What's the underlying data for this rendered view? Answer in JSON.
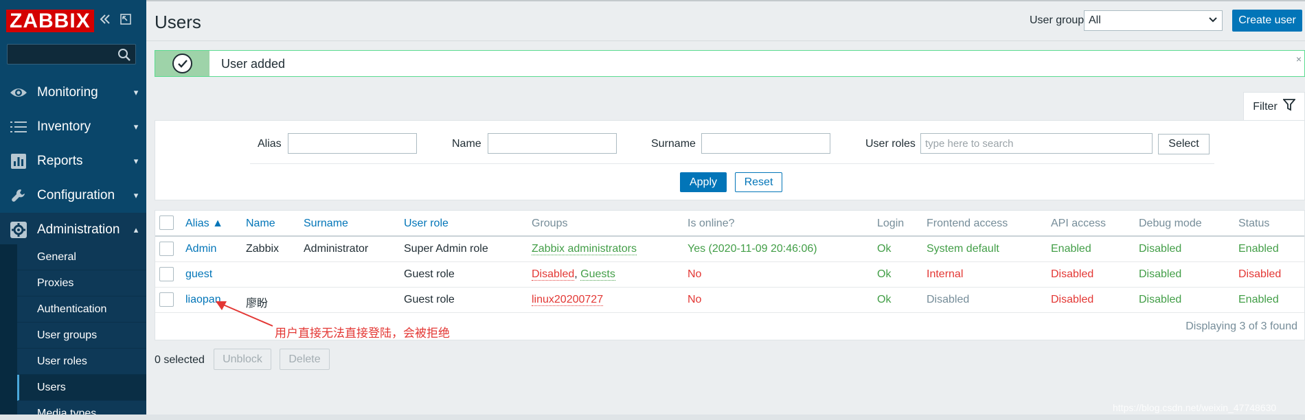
{
  "sidebar": {
    "logo": "ZABBIX",
    "collapse_icon": "double-chevron-left",
    "kiosk_icon": "expand-icon",
    "menu": [
      {
        "label": "Monitoring",
        "icon": "eye-icon",
        "chevron": "⌄"
      },
      {
        "label": "Inventory",
        "icon": "list-icon",
        "chevron": "⌄"
      },
      {
        "label": "Reports",
        "icon": "bar-chart-icon",
        "chevron": "⌄"
      },
      {
        "label": "Configuration",
        "icon": "wrench-icon",
        "chevron": "⌄"
      },
      {
        "label": "Administration",
        "icon": "gear-icon",
        "chevron": "⌃"
      }
    ],
    "submenu": [
      "General",
      "Proxies",
      "Authentication",
      "User groups",
      "User roles",
      "Users",
      "Media types"
    ]
  },
  "header": {
    "title": "Users",
    "user_group_label": "User group",
    "user_group_value": "All",
    "create_button": "Create user"
  },
  "message": {
    "text": "User added",
    "close": "×"
  },
  "filter": {
    "tab_label": "Filter",
    "alias_label": "Alias",
    "name_label": "Name",
    "surname_label": "Surname",
    "roles_label": "User roles",
    "roles_placeholder": "type here to search",
    "select_button": "Select",
    "apply_button": "Apply",
    "reset_button": "Reset"
  },
  "table": {
    "columns": [
      "Alias ▲",
      "Name",
      "Surname",
      "User role",
      "Groups",
      "Is online?",
      "Login",
      "Frontend access",
      "API access",
      "Debug mode",
      "Status"
    ],
    "rows": [
      {
        "alias": "Admin",
        "name": "Zabbix",
        "surname": "Administrator",
        "role": "Super Admin role",
        "groups_a": "Zabbix administrators",
        "groups_sep": "",
        "groups_b": "",
        "online": "Yes (2020-11-09 20:46:06)",
        "login": "Ok",
        "frontend": "System default",
        "api": "Enabled",
        "debug": "Disabled",
        "status": "Enabled"
      },
      {
        "alias": "guest",
        "name": "",
        "surname": "",
        "role": "Guest role",
        "groups_a": "Disabled",
        "groups_sep": ", ",
        "groups_b": "Guests",
        "online": "No",
        "login": "Ok",
        "frontend": "Internal",
        "api": "Disabled",
        "debug": "Disabled",
        "status": "Disabled"
      },
      {
        "alias": "liaopan",
        "name": "廖盼",
        "surname": "",
        "role": "Guest role",
        "groups_a": "linux20200727",
        "groups_sep": "",
        "groups_b": "",
        "online": "No",
        "login": "Ok",
        "frontend": "Disabled",
        "api": "Disabled",
        "debug": "Disabled",
        "status": "Enabled"
      }
    ],
    "footer": "Displaying 3 of 3 found"
  },
  "annotation": "用户直接无法直接登陆，会被拒绝",
  "actions": {
    "selected": "0 selected",
    "unblock": "Unblock",
    "delete": "Delete"
  },
  "watermark": "https://blog.csdn.net/weixin_47748630",
  "colors": {
    "sidebar": "#0a466a",
    "logo_red": "#d40000",
    "primary_blue": "#0275b8",
    "ok_green": "#429e47",
    "error_red": "#e33734",
    "success_bg": "#9ed3a9"
  }
}
